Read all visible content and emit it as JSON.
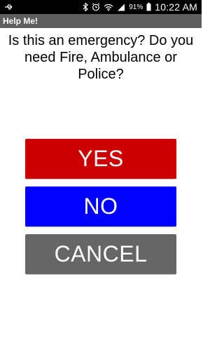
{
  "status_bar": {
    "battery_percent": "91%",
    "time": "10:22 AM",
    "icons": [
      "usb-icon",
      "bluetooth-icon",
      "alarm-icon",
      "wifi-icon",
      "signal-icon",
      "battery-icon"
    ]
  },
  "app": {
    "title": "Help Me!"
  },
  "prompt": {
    "question": "Is this an emergency? Do you need Fire, Ambulance or Police?"
  },
  "buttons": {
    "yes": {
      "label": "YES",
      "color": "#cc0000"
    },
    "no": {
      "label": "NO",
      "color": "#0000ff"
    },
    "cancel": {
      "label": "CANCEL",
      "color": "#666666"
    }
  }
}
